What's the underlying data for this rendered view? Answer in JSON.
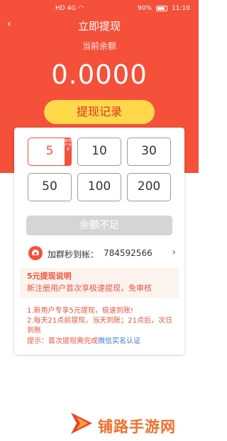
{
  "status": {
    "battery": "90%",
    "time": "11:10",
    "network": "HD 4G"
  },
  "header": {
    "title": "立即提现",
    "balance_label": "当前余额",
    "balance_value": "0.0000",
    "record_button": "提现记录"
  },
  "amounts": [
    {
      "value": "5",
      "tag": "新用户专享",
      "selected": true
    },
    {
      "value": "10"
    },
    {
      "value": "30"
    },
    {
      "value": "50"
    },
    {
      "value": "100"
    },
    {
      "value": "200"
    }
  ],
  "insufficient_label": "余额不足",
  "group": {
    "label": "加群秒到帐：",
    "number": "784592566"
  },
  "info": {
    "title": "5元提现说明",
    "body": "新注册用户首次享极速提现，免审核"
  },
  "notes": {
    "line1": "1.新用户专享5元提现，极速到账!",
    "line2": "2.每天21点前提现，当天到账；21点后，次日到账"
  },
  "hint": {
    "prefix": "提示：首次提现需完成",
    "link": "微信实名认证"
  },
  "watermark": "铺路手游网",
  "colors": {
    "brand": "#f4503a",
    "button_yellow": "#ffd84a",
    "link": "#3a7bd5"
  }
}
